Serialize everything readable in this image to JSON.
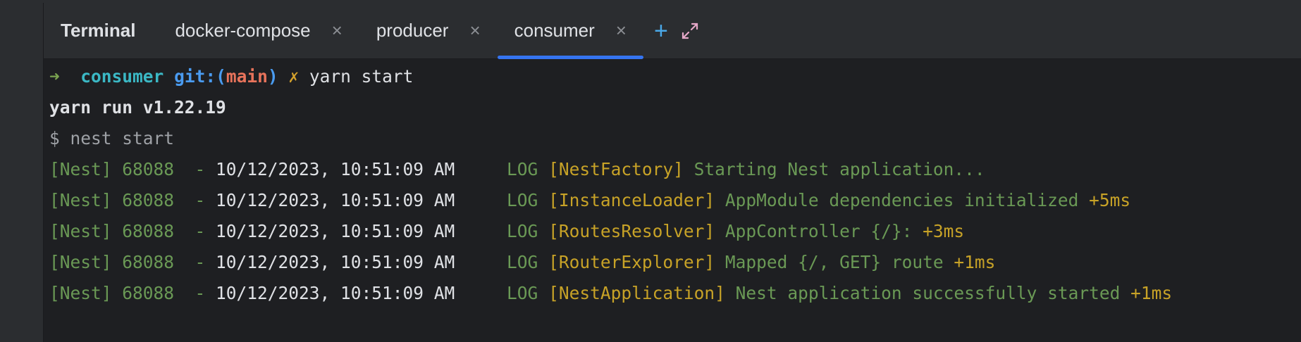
{
  "toolwindow": {
    "title": "Terminal",
    "tabs": [
      {
        "label": "docker-compose",
        "close": "×",
        "active": false
      },
      {
        "label": "producer",
        "close": "×",
        "active": false
      },
      {
        "label": "consumer",
        "close": "×",
        "active": true
      }
    ],
    "new_tab_icon": "plus-icon",
    "maximize_icon": "expand-icon"
  },
  "terminal": {
    "prompt": {
      "arrow": "➜",
      "dir": "consumer",
      "git_prefix": "git:(",
      "branch": "main",
      "git_suffix": ")",
      "dirty_mark": "✗",
      "command": "yarn start"
    },
    "yarn_line": "yarn run v1.22.19",
    "cmd_line": "$ nest start",
    "logs": [
      {
        "prefix": "[Nest] 68088  - ",
        "time": "10/12/2023, 10:51:09 AM",
        "level": "LOG",
        "context": "[NestFactory]",
        "message": "Starting Nest application...",
        "suffix": ""
      },
      {
        "prefix": "[Nest] 68088  - ",
        "time": "10/12/2023, 10:51:09 AM",
        "level": "LOG",
        "context": "[InstanceLoader]",
        "message": "AppModule dependencies initialized",
        "suffix": "+5ms"
      },
      {
        "prefix": "[Nest] 68088  - ",
        "time": "10/12/2023, 10:51:09 AM",
        "level": "LOG",
        "context": "[RoutesResolver]",
        "message": "AppController {/}:",
        "suffix": "+3ms"
      },
      {
        "prefix": "[Nest] 68088  - ",
        "time": "10/12/2023, 10:51:09 AM",
        "level": "LOG",
        "context": "[RouterExplorer]",
        "message": "Mapped {/, GET} route",
        "suffix": "+1ms"
      },
      {
        "prefix": "[Nest] 68088  - ",
        "time": "10/12/2023, 10:51:09 AM",
        "level": "LOG",
        "context": "[NestApplication]",
        "message": "Nest application successfully started",
        "suffix": "+1ms"
      }
    ]
  },
  "colors": {
    "background": "#1e1f22",
    "tabbar": "#2b2d30",
    "accent": "#3574f0",
    "log_green": "#6a9955",
    "log_context": "#c7a227"
  }
}
